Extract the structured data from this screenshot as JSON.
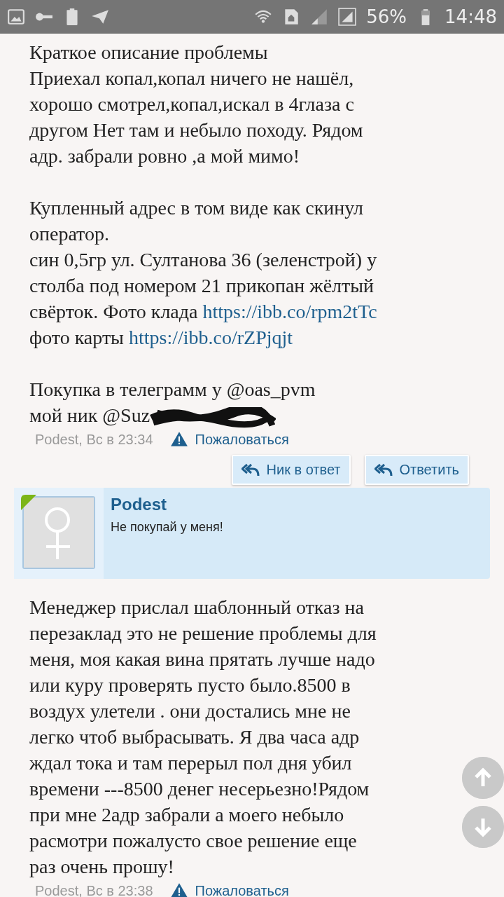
{
  "status_bar": {
    "battery": "56%",
    "time": "14:48"
  },
  "posts": [
    {
      "paragraphs": [
        [
          [
            {
              "kind": "text",
              "text": "Краткое описание проблемы"
            }
          ],
          [
            {
              "kind": "text",
              "text": "Приехал копал,копал ничего не нашёл,"
            }
          ],
          [
            {
              "kind": "text",
              "text": "хорошо смотрел,копал,искал в 4глаза с"
            }
          ],
          [
            {
              "kind": "text",
              "text": "другом Нет там и небыло походу. Рядом"
            }
          ],
          [
            {
              "kind": "text",
              "text": "адр. забрали ровно ,а мой мимо!"
            }
          ]
        ],
        [
          [
            {
              "kind": "text",
              "text": "Купленный адрес в том виде как скинул"
            }
          ],
          [
            {
              "kind": "text",
              "text": "оператор."
            }
          ],
          [
            {
              "kind": "text",
              "text": "син 0,5гр ул. Султанова 36 (зеленстрой) у"
            }
          ],
          [
            {
              "kind": "text",
              "text": "столба под номером 21 прикопан жёлтый"
            }
          ],
          [
            {
              "kind": "text",
              "text": "свёрток. Фото клада "
            },
            {
              "kind": "link",
              "text": "https://ibb.co/rpm2tTc"
            }
          ],
          [
            {
              "kind": "text",
              "text": "фото карты "
            },
            {
              "kind": "link",
              "text": "https://ibb.co/rZPjqjt"
            }
          ]
        ],
        [
          [
            {
              "kind": "text",
              "text": "Покупка в телеграмм у @oas_pvm"
            }
          ],
          [
            {
              "kind": "text",
              "text": "мой ник @Suz"
            },
            {
              "kind": "redacted"
            }
          ]
        ]
      ],
      "meta": "Podest, Вс в 23:34",
      "report": "Пожаловаться",
      "buttons": [
        "Ник в ответ",
        "Ответить"
      ]
    },
    {
      "quote": {
        "author": "Podest",
        "text": "Не покупай у меня!"
      },
      "paragraphs": [
        [
          [
            {
              "kind": "text",
              "text": "Менеджер прислал шаблонный отказ на"
            }
          ],
          [
            {
              "kind": "text",
              "text": "перезаклад это не решение проблемы для"
            }
          ],
          [
            {
              "kind": "text",
              "text": "меня, моя какая вина прятать лучше надо"
            }
          ],
          [
            {
              "kind": "text",
              "text": "или куру проверять пусто было.8500 в"
            }
          ],
          [
            {
              "kind": "text",
              "text": "воздух улетели . они достались мне не"
            }
          ],
          [
            {
              "kind": "text",
              "text": "легко чтоб выбрасывать. Я два часа адр"
            }
          ],
          [
            {
              "kind": "text",
              "text": "ждал тока и там перерыл пол дня убил"
            }
          ],
          [
            {
              "kind": "text",
              "text": "времени ---8500 денег несерьезно!Рядом"
            }
          ],
          [
            {
              "kind": "text",
              "text": "при мне 2адр забрали а моего небыло"
            }
          ],
          [
            {
              "kind": "text",
              "text": "расмотри пожалусто свое решение еще"
            }
          ],
          [
            {
              "kind": "text",
              "text": "раз очень прошу!"
            }
          ]
        ]
      ],
      "meta": "Podest, Вс в 23:38",
      "report": "Пожаловаться"
    }
  ]
}
